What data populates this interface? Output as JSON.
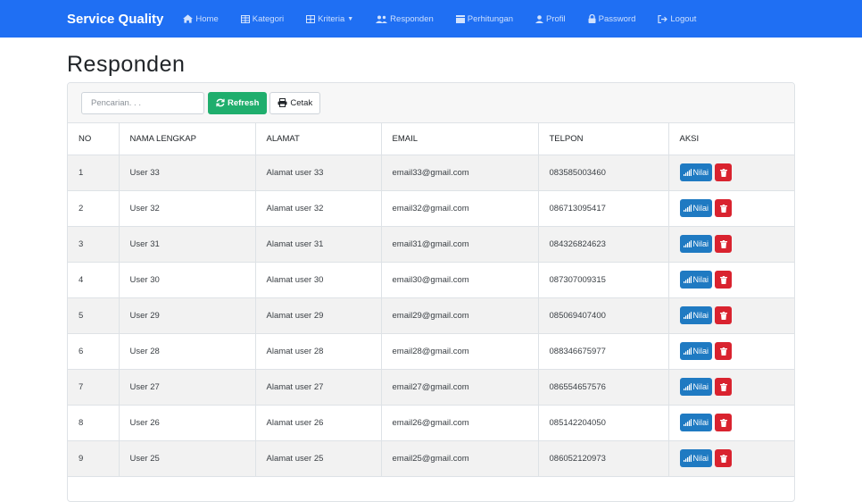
{
  "nav": {
    "brand": "Service Quality",
    "items": [
      {
        "label": "Home",
        "icon": "home-icon"
      },
      {
        "label": "Kategori",
        "icon": "table-icon"
      },
      {
        "label": "Kriteria",
        "icon": "grid-icon"
      },
      {
        "label": "Responden",
        "icon": "users-icon"
      },
      {
        "label": "Perhitungan",
        "icon": "calculator-icon"
      },
      {
        "label": "Profil",
        "icon": "user-icon"
      },
      {
        "label": "Password",
        "icon": "lock-icon"
      },
      {
        "label": "Logout",
        "icon": "logout-icon"
      }
    ]
  },
  "page": {
    "title": "Responden"
  },
  "toolbar": {
    "search_placeholder": "Pencarian. . .",
    "refresh_label": "Refresh",
    "print_label": "Cetak"
  },
  "table": {
    "headers": [
      "NO",
      "NAMA LENGKAP",
      "ALAMAT",
      "EMAIL",
      "TELPON",
      "AKSI"
    ],
    "action_label": "Nilai",
    "rows": [
      {
        "no": "1",
        "nama": "User 33",
        "alamat": "Alamat user 33",
        "email": "email33@gmail.com",
        "telpon": "083585003460"
      },
      {
        "no": "2",
        "nama": "User 32",
        "alamat": "Alamat user 32",
        "email": "email32@gmail.com",
        "telpon": "086713095417"
      },
      {
        "no": "3",
        "nama": "User 31",
        "alamat": "Alamat user 31",
        "email": "email31@gmail.com",
        "telpon": "084326824623"
      },
      {
        "no": "4",
        "nama": "User 30",
        "alamat": "Alamat user 30",
        "email": "email30@gmail.com",
        "telpon": "087307009315"
      },
      {
        "no": "5",
        "nama": "User 29",
        "alamat": "Alamat user 29",
        "email": "email29@gmail.com",
        "telpon": "085069407400"
      },
      {
        "no": "6",
        "nama": "User 28",
        "alamat": "Alamat user 28",
        "email": "email28@gmail.com",
        "telpon": "088346675977"
      },
      {
        "no": "7",
        "nama": "User 27",
        "alamat": "Alamat user 27",
        "email": "email27@gmail.com",
        "telpon": "086554657576"
      },
      {
        "no": "8",
        "nama": "User 26",
        "alamat": "Alamat user 26",
        "email": "email26@gmail.com",
        "telpon": "085142204050"
      },
      {
        "no": "9",
        "nama": "User 25",
        "alamat": "Alamat user 25",
        "email": "email25@gmail.com",
        "telpon": "086052120973"
      }
    ]
  },
  "colors": {
    "navbar": "#1f6ff3",
    "refresh": "#1fae6d",
    "nilai": "#1f7ac2",
    "delete": "#d9232f"
  }
}
